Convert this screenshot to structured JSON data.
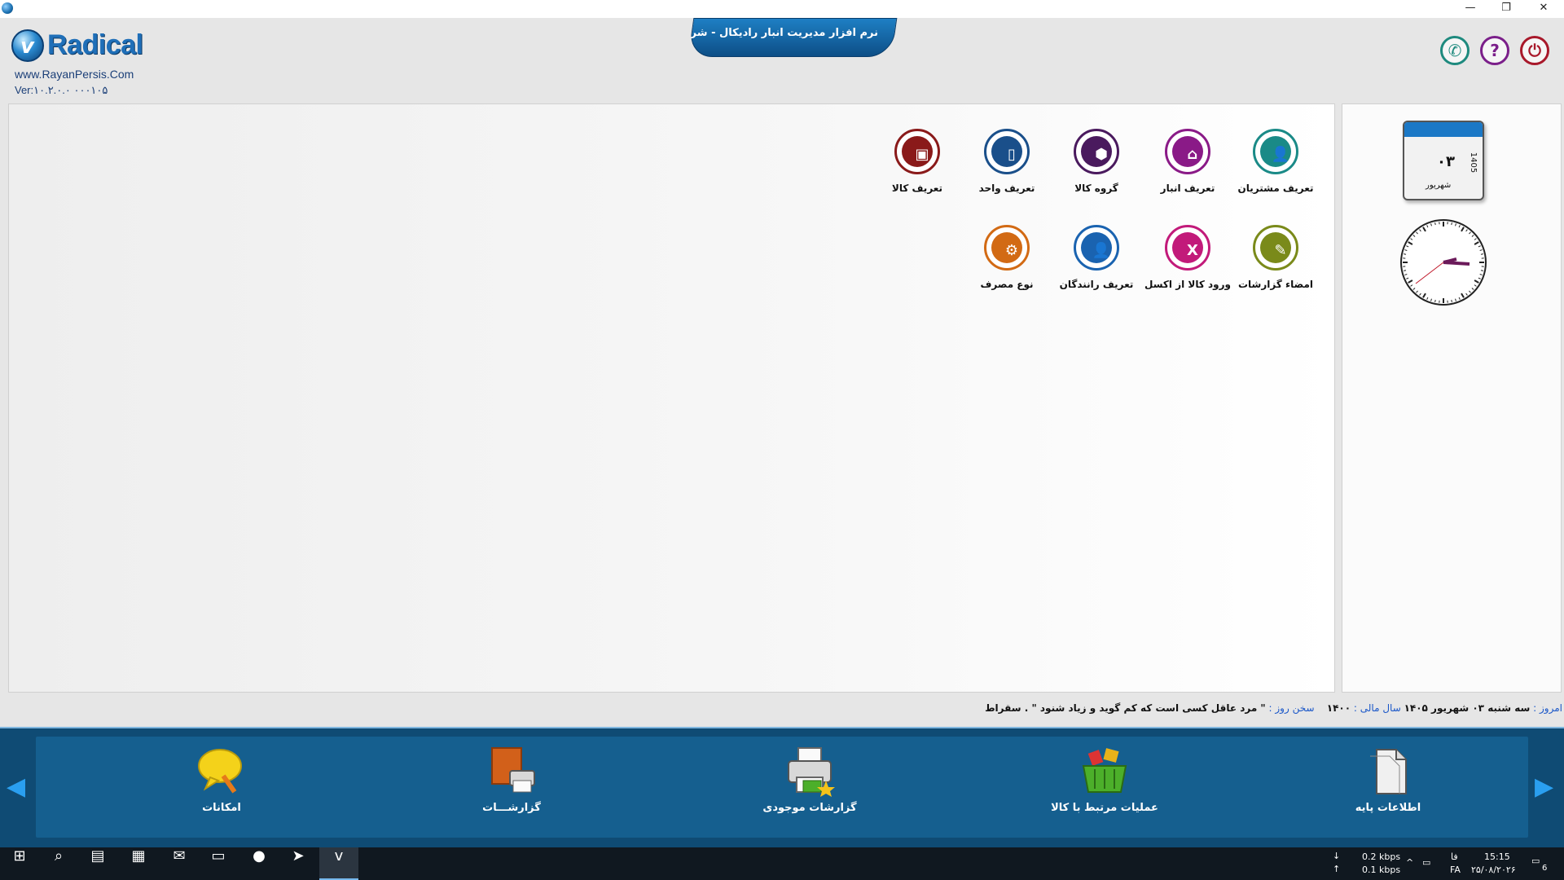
{
  "window": {
    "min": "—",
    "max": "❐",
    "close": "✕"
  },
  "header": {
    "logo_text": "Radical",
    "website": "www.RayanPersis.Com",
    "version": "Ver:۱۰.۲.۰.۰   ۰۰۰۱۰۵",
    "title": "نرم افزار مدیریت انبار رادیکال - شرکت"
  },
  "header_icons": [
    {
      "name": "phone-icon",
      "glyph": "✆"
    },
    {
      "name": "help-icon",
      "glyph": "?"
    },
    {
      "name": "exit-icon",
      "glyph": "⏻"
    }
  ],
  "grid": [
    {
      "label": "تعریف مشتریان",
      "icon": "customer-icon",
      "color": "#1a8a87",
      "glyph": "👤"
    },
    {
      "label": "تعریف انبار",
      "icon": "warehouse-icon",
      "color": "#8a1a87",
      "glyph": "⌂"
    },
    {
      "label": "گروه کالا",
      "icon": "product-group-icon",
      "color": "#4a1a5e",
      "glyph": "⬢"
    },
    {
      "label": "تعریف واحد",
      "icon": "unit-icon",
      "color": "#1a4f8a",
      "glyph": "▯"
    },
    {
      "label": "تعریف کالا",
      "icon": "product-icon",
      "color": "#8a1a1a",
      "glyph": "▣"
    },
    {
      "label": "امضاء گزارشات",
      "icon": "signature-icon",
      "color": "#7a8a1a",
      "glyph": "✎"
    },
    {
      "label": "ورود کالا از اکسل",
      "icon": "excel-import-icon",
      "color": "#c21a7a",
      "glyph": "X"
    },
    {
      "label": "تعریف رانندگان",
      "icon": "driver-icon",
      "color": "#1a63b0",
      "glyph": "👤"
    },
    {
      "label": "نوع مصرف",
      "icon": "consumption-type-icon",
      "color": "#d26a14",
      "glyph": "⚙"
    }
  ],
  "calendar": {
    "day": "۰۳",
    "month": "شهریور",
    "year": "1405"
  },
  "status": {
    "today_label": "امروز :",
    "today_value": "سه شنبه ۰۳ شهریور ۱۴۰۵",
    "fiscal_label": "سال مالی :",
    "fiscal_value": "۱۴۰۰",
    "quote_label": "سخن روز :",
    "quote_value": "\" مرد عاقل کسی است که کم گوید و زیاد شنود \" . سقراط"
  },
  "bottom_nav": [
    {
      "label": "اطلاعات پایه",
      "icon": "base-info-icon"
    },
    {
      "label": "عملیات مرتبط با کالا",
      "icon": "basket-icon"
    },
    {
      "label": "گزارشات موجودی",
      "icon": "printer-icon"
    },
    {
      "label": "گزارشـــات",
      "icon": "report-icon"
    },
    {
      "label": "امکانات",
      "icon": "bulb-icon"
    }
  ],
  "taskbar": {
    "speed_down": "0.2 kbps",
    "speed_up": "0.1 kbps",
    "lang_a": "فا",
    "lang_b": "FA",
    "time": "15:15",
    "date": "۲۵/۰۸/۲۰۲۶",
    "notifications": "6"
  }
}
